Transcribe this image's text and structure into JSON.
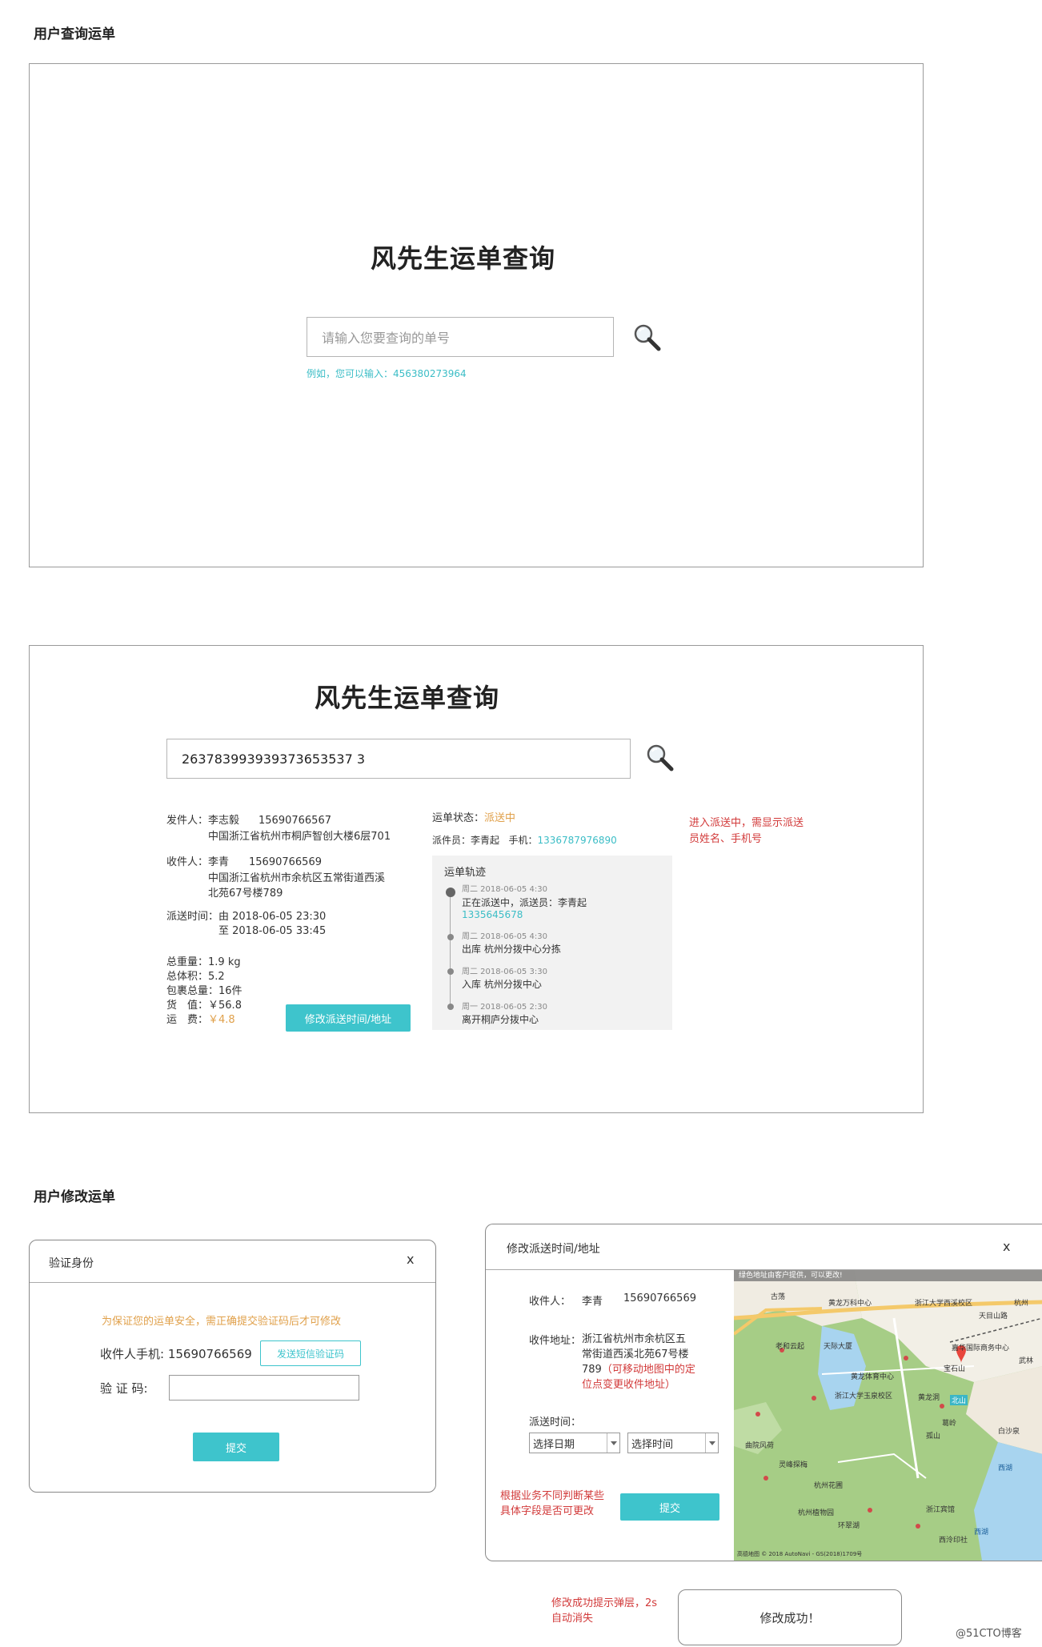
{
  "sections": {
    "query_title": "用户查询运单",
    "modify_title": "用户修改运单"
  },
  "query_page": {
    "title": "风先生运单查询",
    "search_placeholder": "请输入您要查询的单号",
    "hint_prefix": "例如，您可以输入：",
    "hint_example": "456380273964"
  },
  "result_page": {
    "title": "风先生运单查询",
    "search_value": "263783993939373653537 3",
    "sender": {
      "label": "发件人：",
      "name": "李志毅",
      "phone": "15690766567",
      "address": "中国浙江省杭州市桐庐智创大楼6层701"
    },
    "receiver": {
      "label": "收件人：",
      "name": "李青",
      "phone": "15690766569",
      "address_line1": "中国浙江省杭州市余杭区五常街道西溪",
      "address_line2": "北苑67号楼789"
    },
    "delivery_time": {
      "label": "派送时间：",
      "from": "由 2018-06-05 23:30",
      "to": "至 2018-06-05 33:45"
    },
    "stats": [
      {
        "label": "总重量：",
        "value": "1.9 kg"
      },
      {
        "label": "总体积：",
        "value": "5.2"
      },
      {
        "label": "包裹总量：",
        "value": "16件"
      },
      {
        "label": "货　值：",
        "value": "￥56.8"
      },
      {
        "label": "运　费：",
        "value": "￥4.8"
      }
    ],
    "modify_button": "修改派送时间/地址",
    "status_label": "运单状态：",
    "status_value": "派送中",
    "courier_label": "派件员：",
    "courier_name": "李青起",
    "courier_phone_label": "手机：",
    "courier_phone": "1336787976890",
    "track_title": "运单轨迹",
    "track": [
      {
        "time": "周二 2018-06-05 4:30",
        "text": "正在派送中，派送员：李青起",
        "extra": "1335645678"
      },
      {
        "time": "周二 2018-06-05 4:30",
        "text": "出库 杭州分拨中心分拣",
        "extra": ""
      },
      {
        "time": "周二 2018-06-05 3:30",
        "text": "入库 杭州分拨中心",
        "extra": ""
      },
      {
        "time": "周一 2018-06-05 2:30",
        "text": "离开桐庐分拨中心",
        "extra": ""
      }
    ],
    "note": "进入派送中，需显示派送员姓名、手机号"
  },
  "verify_dialog": {
    "title": "验证身份",
    "close": "x",
    "warning": "为保证您的运单安全，需正确提交验证码后才可修改",
    "phone_label": "收件人手机: 15690766569",
    "send_code_button": "发送短信验证码",
    "code_label": "验 证 码:",
    "submit": "提交"
  },
  "modify_dialog": {
    "title": "修改派送时间/地址",
    "close": "x",
    "receiver_label": "收件人：",
    "receiver_name": "李青",
    "receiver_phone": "15690766569",
    "address_label": "收件地址：",
    "address_l1": "浙江省杭州市余杭区五",
    "address_l2": "常街道西溪北苑67号楼",
    "address_l3": "789",
    "address_note_l1": "（可移动地图中的定",
    "address_note_l2": "位点变更收件地址）",
    "time_label": "派送时间：",
    "date_select": "选择日期",
    "time_select": "选择时间",
    "note_l1": "根据业务不同判断某些",
    "note_l2": "具体字段是否可更改",
    "submit": "提交",
    "map_banner": "绿色地址由客户提供，可以更改!",
    "map_labels": [
      "古荡",
      "黄龙万科中心",
      "浙江大学西溪校区",
      "天目山路",
      "杭州",
      "老和云起",
      "天际大厦",
      "嘉华国际商务中心",
      "武林",
      "黄龙体育中心",
      "宝石山",
      "浙江大学玉泉校区",
      "黄龙洞",
      "北山",
      "葛岭",
      "白沙泉",
      "灵峰探梅",
      "曲院风荷",
      "西湖",
      "杭州植物园",
      "环翠湖",
      "浙江宾馆",
      "孤山",
      "西湖",
      "杭州花圃",
      "西泠印社"
    ],
    "map_copyright": "高德地图 © 2018 AutoNavi - GS(2018)1709号"
  },
  "toast": {
    "note_l1": "修改成功提示弹层，2s",
    "note_l2": "自动消失",
    "text": "修改成功！"
  },
  "watermark": "@51CTO博客"
}
